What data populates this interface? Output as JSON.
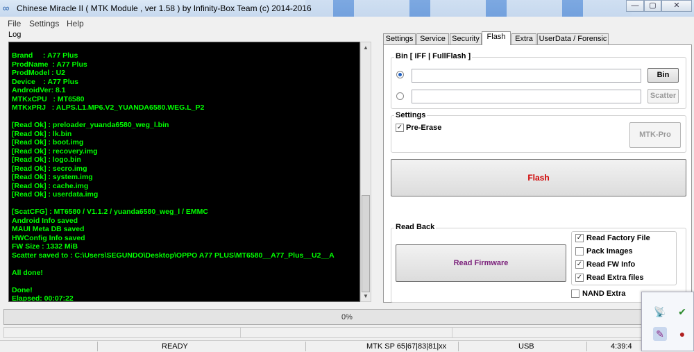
{
  "window": {
    "title": "Chinese Miracle II ( MTK Module , ver 1.58 ) by Infinity-Box Team (c) 2014-2016",
    "minimize": "—",
    "maximize": "▢",
    "close": "✕"
  },
  "menu": [
    "File",
    "Settings",
    "Help"
  ],
  "log": {
    "label": "Log",
    "lines": [
      "Brand     : A77 Plus",
      "ProdName  : A77 Plus",
      "ProdModel : U2",
      "Device    : A77 Plus",
      "AndroidVer: 8.1",
      "MTKxCPU   : MT6580",
      "MTKxPRJ   : ALPS.L1.MP6.V2_YUANDA6580.WEG.L_P2",
      "",
      "[Read Ok] : preloader_yuanda6580_weg_l.bin",
      "[Read Ok] : lk.bin",
      "[Read Ok] : boot.img",
      "[Read Ok] : recovery.img",
      "[Read Ok] : logo.bin",
      "[Read Ok] : secro.img",
      "[Read Ok] : system.img",
      "[Read Ok] : cache.img",
      "[Read Ok] : userdata.img",
      "",
      "[ScatCFG] : MT6580 / V1.1.2 / yuanda6580_weg_l / EMMC",
      "Android Info saved",
      "MAUI Meta DB saved",
      "HWConfig Info saved",
      "FW Size : 1332 MiB",
      "Scatter saved to : C:\\Users\\SEGUNDO\\Desktop\\OPPO A77 PLUS\\MT6580__A77_Plus__U2__A",
      "",
      "All done!",
      "",
      "Done!",
      "Elapsed: 00:07:22"
    ]
  },
  "tabs": [
    "Settings",
    "Service",
    "Security",
    "Flash",
    "Extra",
    "UserData / Forensic"
  ],
  "active_tab": "Flash",
  "flash": {
    "bin_group_label": "Bin  [ IFF | FullFlash ]",
    "bin_path": "",
    "scatter_path": "",
    "bin_button": "Bin",
    "scatter_button": "Scatter",
    "settings_label": "Settings",
    "pre_erase_label": "Pre-Erase",
    "pre_erase_checked": true,
    "mtk_pro_button": "MTK-Pro",
    "flash_button": "Flash",
    "flash_color": "#d00000",
    "read_back_label": "Read Back",
    "read_firmware_button": "Read Firmware",
    "read_firmware_color": "#7a1f7a",
    "options": [
      {
        "label": "Read Factory File",
        "checked": true
      },
      {
        "label": "Pack Images",
        "checked": false
      },
      {
        "label": "Read FW Info",
        "checked": true
      },
      {
        "label": "Read Extra files",
        "checked": true
      }
    ],
    "nand_extra_label": "NAND Extra",
    "nand_extra_checked": false
  },
  "progress": {
    "text": "0%",
    "value": 0
  },
  "status": {
    "state": "READY",
    "chip": "MTK SP 65|67|83|81|xx",
    "port": "USB",
    "time": "4:39:4"
  },
  "colors": {
    "log_bg": "#000000",
    "log_text": "#00ff00"
  },
  "tray_icons": [
    "satellite-dish-icon",
    "usb-drive-check-icon",
    "pen-icon",
    "record-dot-icon"
  ]
}
